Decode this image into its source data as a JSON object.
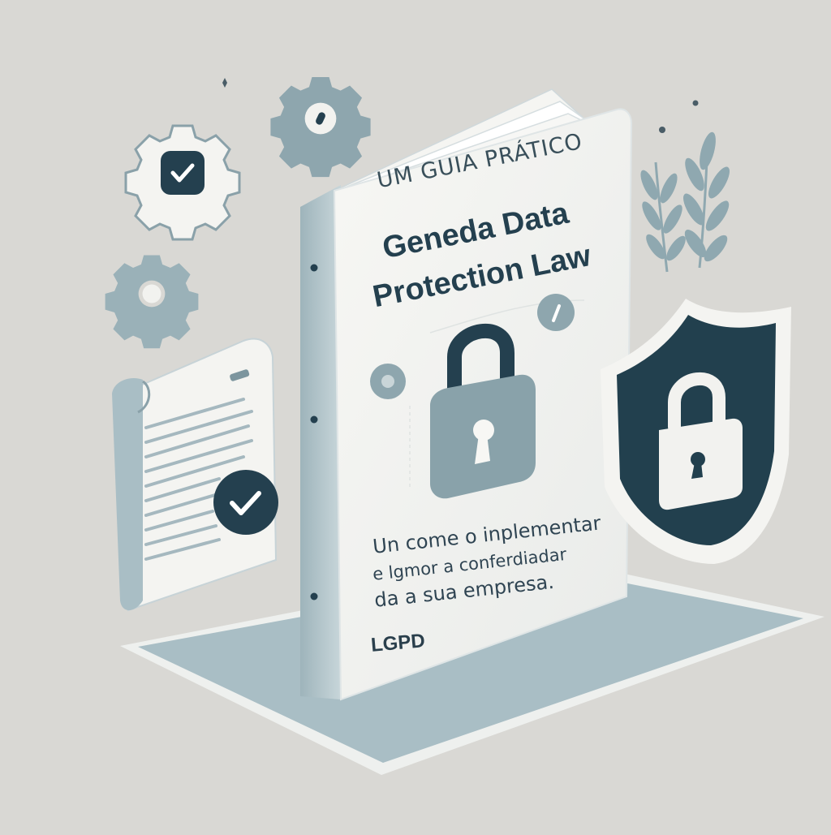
{
  "cover": {
    "subtitle": "UM GUIA PRÁTICO",
    "title_line1": "Geneda Data",
    "title_line2": "Protection Law",
    "description_line1": "Un come o inplementar",
    "description_line2": "e lgmor a conferdiadar",
    "description_line3": "da a sua empresa.",
    "tag": "LGPD"
  },
  "icons": [
    "gear-check-icon",
    "gear-dot-icon",
    "gear-icon",
    "leaf-branch-icon",
    "document-check-icon",
    "padlock-icon",
    "shield-lock-icon"
  ],
  "colors": {
    "background": "#d9d8d4",
    "primary_dark": "#22404e",
    "slate_teal": "#88a3ac",
    "platform": "#a9bec5",
    "paper": "#f2f2ef"
  }
}
